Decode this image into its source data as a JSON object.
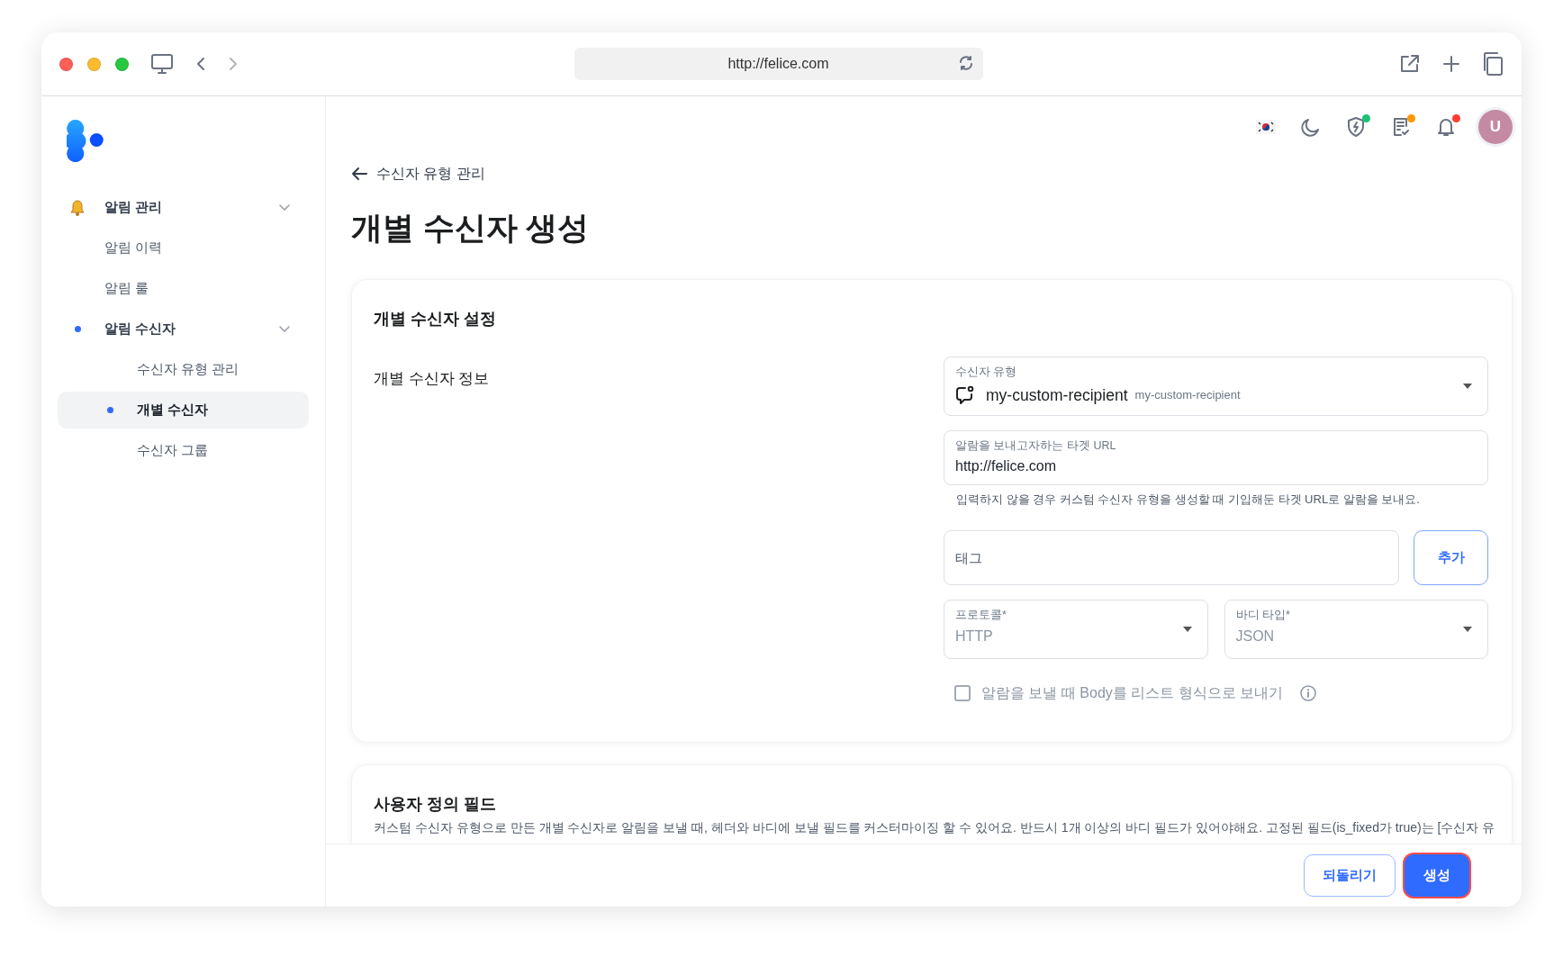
{
  "browser": {
    "url": "http://felice.com"
  },
  "sidebar": {
    "items": [
      {
        "label": "알림 관리",
        "kind": "bell",
        "expanded": true,
        "selected": false,
        "children": [
          {
            "label": "알림 이력",
            "selected": false
          },
          {
            "label": "알림 룰",
            "selected": false
          },
          {
            "label": "알림 수신자",
            "expanded": true,
            "selected": false,
            "children": [
              {
                "label": "수신자 유형 관리",
                "selected": false
              },
              {
                "label": "개별 수신자",
                "selected": true
              },
              {
                "label": "수신자 그룹",
                "selected": false
              }
            ]
          }
        ]
      }
    ]
  },
  "header": {
    "icons": [
      {
        "kind": "flag"
      },
      {
        "kind": "moon"
      },
      {
        "kind": "shield",
        "color": "#1fbf75"
      },
      {
        "kind": "document",
        "color": "#ff9500"
      },
      {
        "kind": "bell",
        "color": "#ff3b30"
      }
    ],
    "avatar": "U"
  },
  "back_link": "수신자 유형 관리",
  "title": "개별 수신자 생성",
  "settings": {
    "title": "개별 수신자 설정",
    "label": "개별 수신자 정보",
    "recipient_type": {
      "label": "수신자 유형",
      "value": "my-custom-recipient",
      "secondary": "my-custom-recipient"
    },
    "target_url": {
      "label": "알람을 보내고자하는 타겟 URL",
      "value": "http://felice.com",
      "help": "입력하지 않을 경우 커스텀 수신자 유형을 생성할 때 기입해둔 타겟 URL로 알람을 보내요."
    },
    "tag": {
      "placeholder": "태그",
      "button": "추가"
    },
    "protocol": {
      "label": "프로토콜*",
      "value": "HTTP",
      "disabled": true
    },
    "body_type": {
      "label": "바디 타입*",
      "value": "JSON",
      "disabled": true
    },
    "list_body": {
      "label": "알람을 보낼 때 Body를 리스트 형식으로 보내기",
      "checked": false,
      "disabled": true
    }
  },
  "custom_fields": {
    "title": "사용자 정의 필드",
    "description": "커스텀 수신자 유형으로 만든 개별 수신자로 알림을 보낼 때, 헤더와 바디에 보낼 필드를 커스터마이징 할 수 있어요. 반드시 1개 이상의 바디 필드가 있어야해요. 고정된 필드(is_fixed가 true)는 [수신자 유"
  },
  "footer": {
    "buttons": [
      {
        "label": "되돌리기",
        "kind": "outline",
        "focused": false
      },
      {
        "label": "생성",
        "kind": "primary",
        "focused": true
      }
    ]
  }
}
